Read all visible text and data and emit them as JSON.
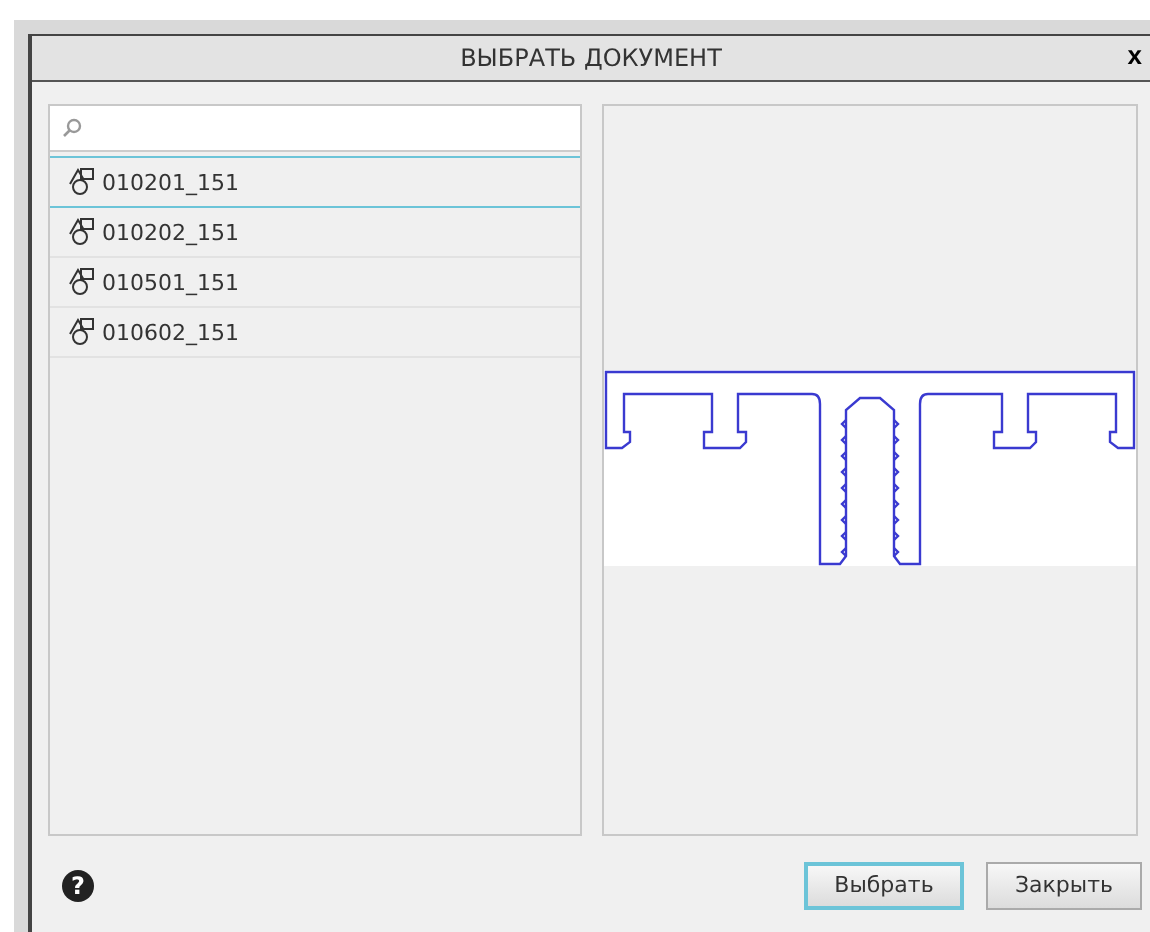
{
  "window": {
    "title": "ВЫБРАТЬ ДОКУМЕНТ",
    "close": "x"
  },
  "documents": [
    {
      "name": "010201_151",
      "selected": true
    },
    {
      "name": "010202_151",
      "selected": false
    },
    {
      "name": "010501_151",
      "selected": false
    },
    {
      "name": "010602_151",
      "selected": false
    }
  ],
  "help": "?",
  "buttons": [
    {
      "label": "Выбрать",
      "kind": "primary"
    },
    {
      "label": "Закрыть",
      "kind": "normal"
    }
  ]
}
